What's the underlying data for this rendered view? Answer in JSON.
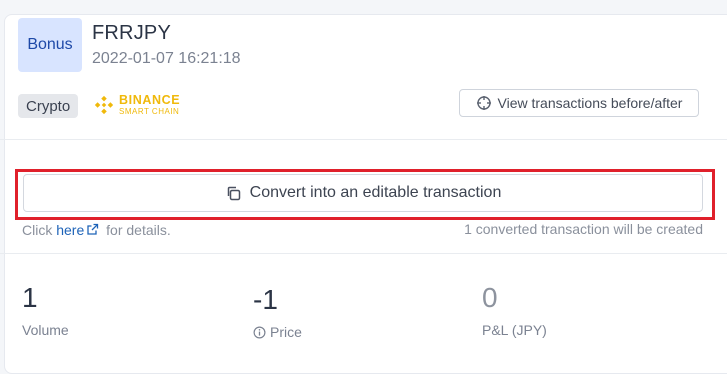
{
  "transaction": {
    "badge": "Bonus",
    "title": "FRRJPY",
    "timestamp": "2022-01-07 16:21:18",
    "asset_tag": "Crypto",
    "chain_logo": {
      "line1": "BINANCE",
      "line2": "SMART CHAIN",
      "color": "#f0b90b"
    },
    "view_button": "View transactions before/after"
  },
  "convert": {
    "button": "Convert into an editable transaction",
    "help_prefix": "Click",
    "help_link": "here",
    "help_suffix": "for details.",
    "note": "1 converted transaction will be created"
  },
  "stats": {
    "volume": {
      "value": "1",
      "label": "Volume"
    },
    "price": {
      "value": "-1",
      "label": "Price"
    },
    "pnl": {
      "value": "0",
      "label": "P&L (JPY)"
    }
  },
  "colors": {
    "highlight": "#e0202b",
    "link": "#1e63b8",
    "badge_bg": "#d8e4ff"
  }
}
